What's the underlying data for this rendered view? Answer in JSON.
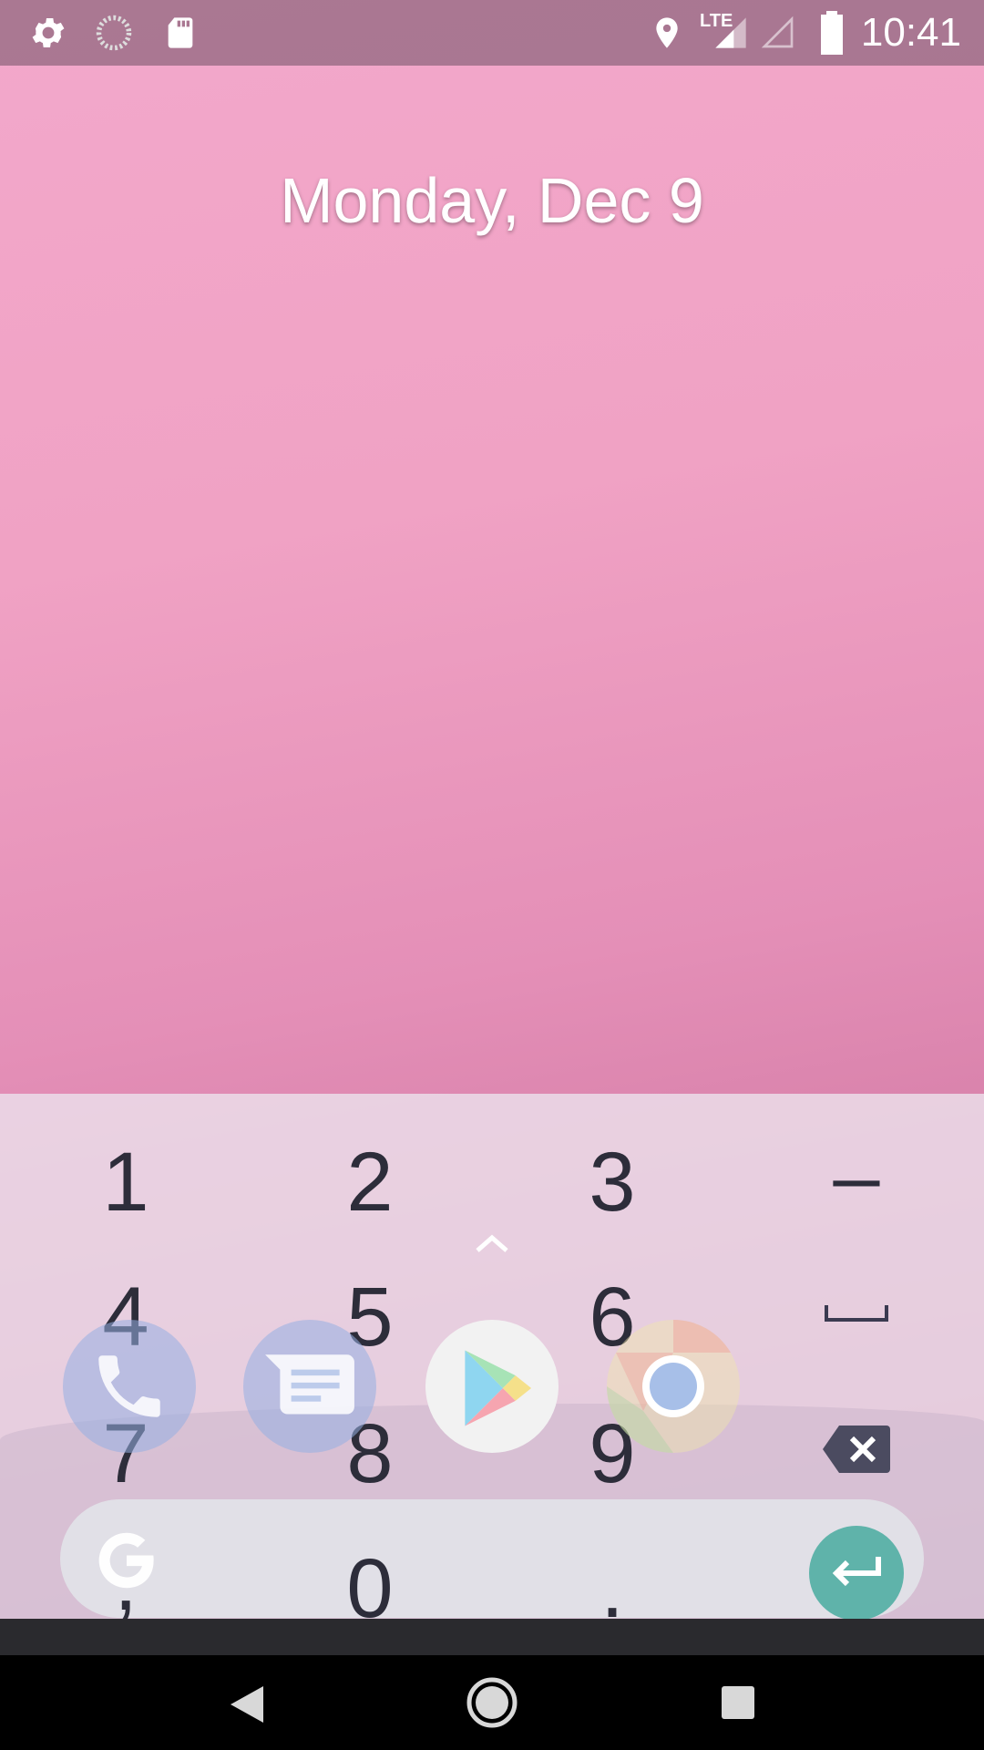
{
  "status_bar": {
    "time": "10:41",
    "network": "LTE",
    "left_icons": [
      "gear-icon",
      "sync-icon",
      "sd-card-icon"
    ],
    "right_icons": [
      "location-icon",
      "signal-icon",
      "signal-empty-icon",
      "battery-icon"
    ]
  },
  "home": {
    "date": "Monday, Dec 9"
  },
  "keyboard": {
    "rows": [
      [
        "1",
        "2",
        "3",
        "–"
      ],
      [
        "4",
        "5",
        "6",
        "␣"
      ],
      [
        "7",
        "8",
        "9",
        "backspace"
      ],
      [
        ",",
        "0",
        ".",
        "enter"
      ]
    ]
  },
  "dock": {
    "apps": [
      "phone",
      "messages",
      "play-store",
      "chrome"
    ]
  },
  "colors": {
    "accent_enter": "#5fb3aa",
    "wallpaper_top": "#f3a8cb",
    "wallpaper_bottom": "#b85f8e"
  }
}
